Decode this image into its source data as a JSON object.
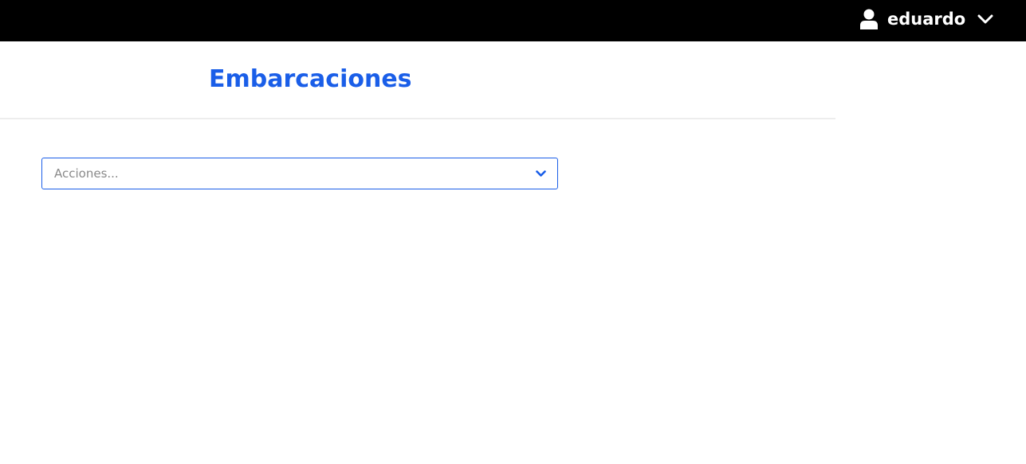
{
  "topbar": {
    "user": {
      "name": "eduardo",
      "icon": "user-icon",
      "chevron_icon": "chevron-down-icon"
    }
  },
  "header": {
    "title": "Embarcaciones"
  },
  "actions": {
    "placeholder": "Acciones...",
    "chevron_icon": "chevron-down-icon"
  },
  "colors": {
    "topbar_bg": "#000000",
    "accent": "#1a5ee8",
    "placeholder_text": "#8a8a8a",
    "divider": "#ededed"
  }
}
